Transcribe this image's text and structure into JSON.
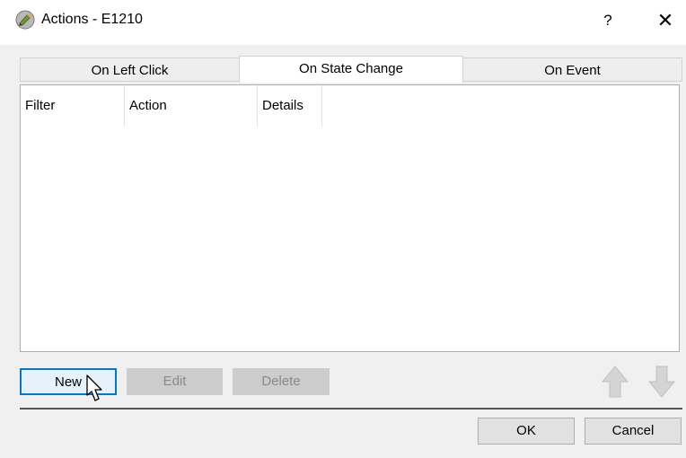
{
  "window": {
    "title": "Actions - E1210",
    "help_label": "?",
    "close_label": "✕"
  },
  "tabs": [
    {
      "label": "On Left Click",
      "active": false
    },
    {
      "label": "On State Change",
      "active": true
    },
    {
      "label": "On Event",
      "active": false
    }
  ],
  "table": {
    "columns": [
      "Filter",
      "Action",
      "Details"
    ],
    "rows": []
  },
  "buttons": {
    "new_label": "New",
    "edit_label": "Edit",
    "delete_label": "Delete",
    "ok_label": "OK",
    "cancel_label": "Cancel"
  },
  "colors": {
    "accent": "#0078d7",
    "disabled_bg": "#cccccc",
    "arrow_fill": "#d4d4d4"
  },
  "icons": {
    "app": "pencil-icon",
    "move_up": "arrow-up-icon",
    "move_down": "arrow-down-icon"
  }
}
